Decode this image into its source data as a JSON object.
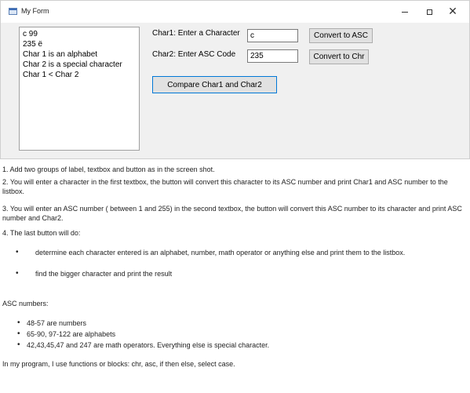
{
  "window": {
    "title": "My Form",
    "min_glyph": "",
    "max_glyph": "",
    "close_glyph": "✕"
  },
  "listbox": {
    "items": [
      "c 99",
      "235 ë",
      "Char 1 is an alphabet",
      "Char 2 is a special character",
      "Char 1 < Char 2"
    ]
  },
  "form": {
    "label1": "Char1: Enter a Character",
    "label2": "Char2: Enter ASC Code",
    "textbox1_value": "c",
    "textbox2_value": "235",
    "btn_asc": "Convert to ASC",
    "btn_chr": "Convert to Chr",
    "btn_compare": "Compare Char1 and Char2"
  },
  "instructions": {
    "p1": "1. Add two groups of label, textbox and button as in the screen shot.",
    "p2": "2. You will enter a character in the first textbox, the button will convert this character to its ASC number and print Char1 and ASC number to the listbox.",
    "p3": "3. You will enter an ASC number ( between 1 and 255) in the second textbox, the button will convert this ASC number to its character and print ASC number and Char2.",
    "p4": "4. The last button will do:",
    "bullets": [
      "determine each character entered is an alphabet, number, math operator or anything else and print them to the listbox.",
      "find the bigger character and print the result"
    ],
    "asc_heading": "ASC numbers:",
    "asc_bullets": [
      "48-57 are numbers",
      "65-90, 97-122 are alphabets",
      "42,43,45,47 and 247 are math operators. Everything else is special character."
    ],
    "footer": "In my program, I use functions or blocks: chr, asc, if then else, select case."
  }
}
